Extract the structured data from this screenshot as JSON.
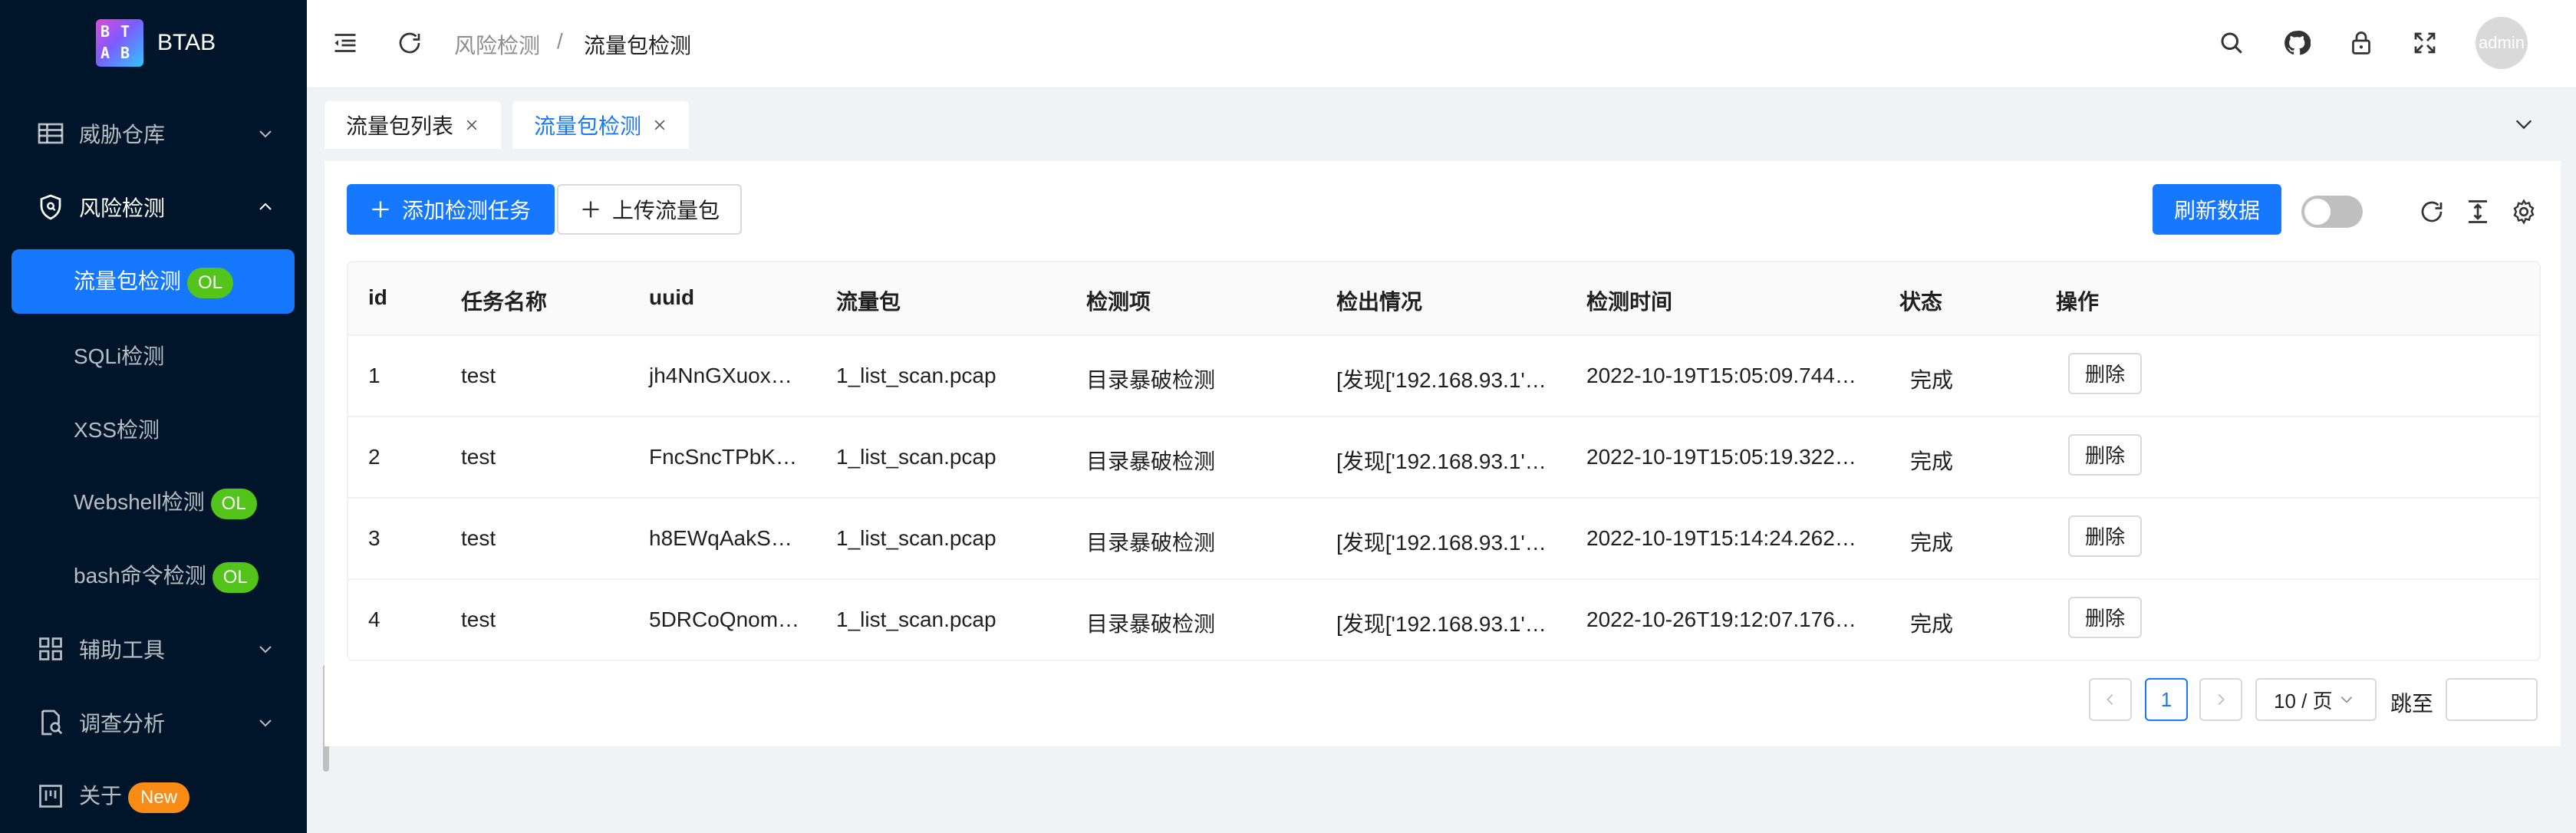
{
  "app": {
    "name": "BTAB"
  },
  "sidebar": {
    "groups": [
      {
        "label": "威胁仓库",
        "icon": "table-icon"
      },
      {
        "label": "风险检测",
        "icon": "shield-icon"
      },
      {
        "label": "辅助工具",
        "icon": "appstore-icon"
      },
      {
        "label": "调查分析",
        "icon": "file-search-icon"
      },
      {
        "label": "关于",
        "icon": "project-icon",
        "tag": "New"
      }
    ],
    "sub_items": [
      {
        "label": "流量包检测",
        "tag": "OL"
      },
      {
        "label": "SQLi检测"
      },
      {
        "label": "XSS检测"
      },
      {
        "label": "Webshell检测",
        "tag": "OL"
      },
      {
        "label": "bash命令检测",
        "tag": "OL"
      }
    ]
  },
  "header": {
    "breadcrumb": [
      "风险检测",
      "流量包检测"
    ],
    "separator": "/",
    "avatar_text": "admin"
  },
  "tabs": [
    {
      "label": "流量包列表",
      "active": false
    },
    {
      "label": "流量包检测",
      "active": true
    }
  ],
  "toolbar": {
    "add_task": "添加检测任务",
    "upload": "上传流量包",
    "refresh_data": "刷新数据",
    "toggle_on": false
  },
  "table": {
    "columns": [
      "id",
      "任务名称",
      "uuid",
      "流量包",
      "检测项",
      "检出情况",
      "检测时间",
      "状态",
      "操作"
    ],
    "rows": [
      {
        "id": "1",
        "name": "test",
        "uuid": "jh4NnGXuox…",
        "pcap": "1_list_scan.pcap",
        "item": "目录暴破检测",
        "result": "[发现['192.168.93.1'…",
        "time": "2022-10-19T15:05:09.744…",
        "status": "完成",
        "action": "删除"
      },
      {
        "id": "2",
        "name": "test",
        "uuid": "FncSncTPbK…",
        "pcap": "1_list_scan.pcap",
        "item": "目录暴破检测",
        "result": "[发现['192.168.93.1'…",
        "time": "2022-10-19T15:05:19.322…",
        "status": "完成",
        "action": "删除"
      },
      {
        "id": "3",
        "name": "test",
        "uuid": "h8EWqAakS…",
        "pcap": "1_list_scan.pcap",
        "item": "目录暴破检测",
        "result": "[发现['192.168.93.1'…",
        "time": "2022-10-19T15:14:24.262…",
        "status": "完成",
        "action": "删除"
      },
      {
        "id": "4",
        "name": "test",
        "uuid": "5DRCoQnom…",
        "pcap": "1_list_scan.pcap",
        "item": "目录暴破检测",
        "result": "[发现['192.168.93.1'…",
        "time": "2022-10-26T19:12:07.176…",
        "status": "完成",
        "action": "删除"
      }
    ]
  },
  "pagination": {
    "current_page": "1",
    "page_size": "10 / 页",
    "jump_label": "跳至"
  },
  "colors": {
    "primary": "#1677ff",
    "sidebar_bg": "#001529",
    "tag_ol": "#52c41a",
    "tag_new": "#fa8c16"
  }
}
